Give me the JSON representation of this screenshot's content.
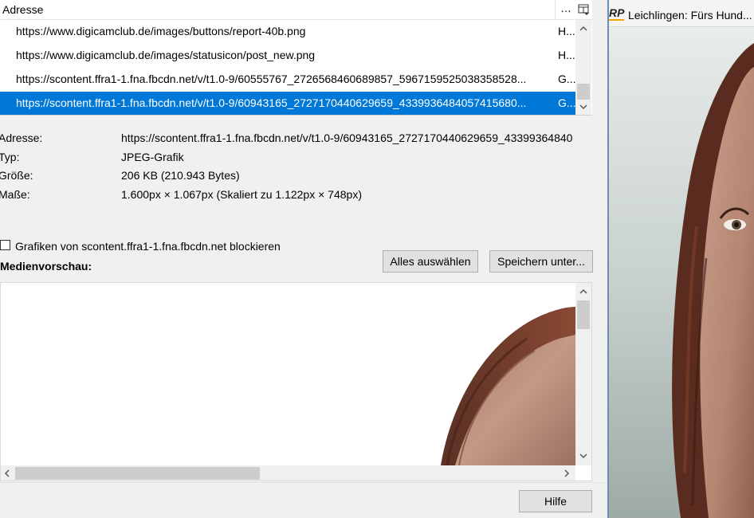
{
  "list": {
    "header_address": "Adresse",
    "header_more": "…",
    "column_picker_icon": "column-picker-icon",
    "rows": [
      {
        "url": "https://www.digicamclub.de/images/buttons/report-40b.png",
        "type": "H...",
        "selected": false
      },
      {
        "url": "https://www.digicamclub.de/images/statusicon/post_new.png",
        "type": "H...",
        "selected": false
      },
      {
        "url": "https://scontent.ffra1-1.fna.fbcdn.net/v/t1.0-9/60555767_2726568460689857_5967159525038358528...",
        "type": "G...",
        "selected": false
      },
      {
        "url": "https://scontent.ffra1-1.fna.fbcdn.net/v/t1.0-9/60943165_2727170440629659_4339936484057415680...",
        "type": "G...",
        "selected": true
      }
    ]
  },
  "info": {
    "address_label": "Adresse:",
    "address_value": "https://scontent.ffra1-1.fna.fbcdn.net/v/t1.0-9/60943165_2727170440629659_43399364840",
    "type_label": "Typ:",
    "type_value": "JPEG-Grafik",
    "size_label": "Größe:",
    "size_value": "206 KB (210.943 Bytes)",
    "dimensions_label": "Maße:",
    "dimensions_value": "1.600px × 1.067px (Skaliert zu 1.122px × 748px)"
  },
  "block": {
    "label": "Grafiken von scontent.ffra1-1.fna.fbcdn.net blockieren",
    "checked": false
  },
  "buttons": {
    "select_all": "Alles auswählen",
    "save_as": "Speichern unter...",
    "help": "Hilfe"
  },
  "preview": {
    "title": "Medienvorschau:"
  },
  "browser": {
    "logo_text": "RP",
    "tab_title": "Leichlingen: Fürs Hund..."
  },
  "colors": {
    "selection": "#0078d7",
    "dialog_bg": "#f0f0f0",
    "logo_accent": "#f0a500"
  }
}
